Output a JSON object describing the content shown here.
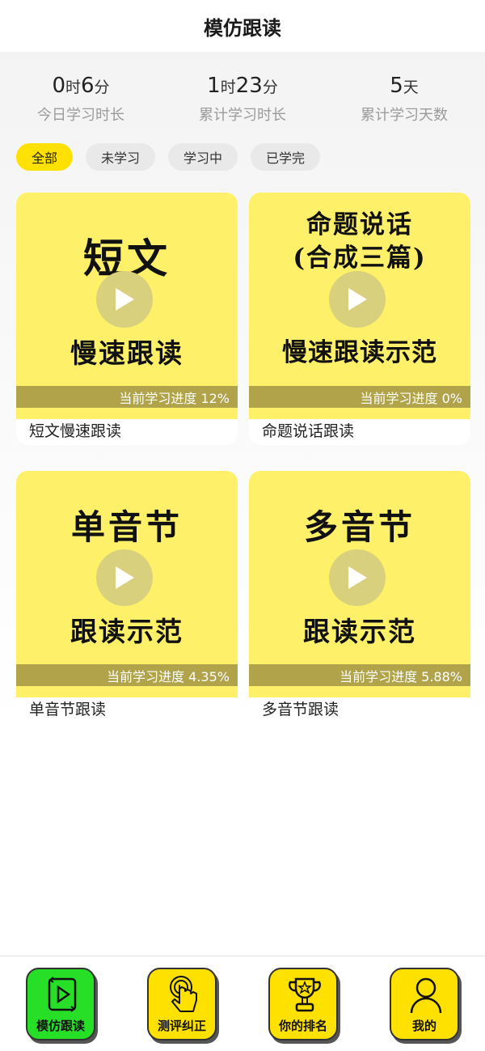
{
  "header": {
    "title": "模仿跟读"
  },
  "stats": [
    {
      "n1": "0",
      "u1": "时",
      "n2": "6",
      "u2": "分",
      "label": "今日学习时长"
    },
    {
      "n1": "1",
      "u1": "时",
      "n2": "23",
      "u2": "分",
      "label": "累计学习时长"
    },
    {
      "n1": "5",
      "u1": "天",
      "n2": "",
      "u2": "",
      "label": "累计学习天数"
    }
  ],
  "filters": [
    "全部",
    "未学习",
    "学习中",
    "已学完"
  ],
  "cards": [
    {
      "top": "短文",
      "top2": "",
      "bottom": "慢速跟读",
      "progress_text": "当前学习进度 12%",
      "progress": 12,
      "caption": "短文慢速跟读"
    },
    {
      "top": "命题说话",
      "top2": "(合成三篇)",
      "bottom": "慢速跟读示范",
      "progress_text": "当前学习进度 0%",
      "progress": 0,
      "caption": "命题说话跟读"
    },
    {
      "top": "单音节",
      "top2": "",
      "bottom": "跟读示范",
      "progress_text": "当前学习进度 4.35%",
      "progress": 4.35,
      "caption": "单音节跟读"
    },
    {
      "top": "多音节",
      "top2": "",
      "bottom": "跟读示范",
      "progress_text": "当前学习进度 5.88%",
      "progress": 5.88,
      "caption": "多音节跟读"
    }
  ],
  "tabs": [
    {
      "label": "模仿跟读",
      "icon": "play-icon",
      "active": true
    },
    {
      "label": "测评纠正",
      "icon": "touch-icon",
      "active": false
    },
    {
      "label": "你的排名",
      "icon": "trophy-icon",
      "active": false
    },
    {
      "label": "我的",
      "icon": "user-icon",
      "active": false
    }
  ],
  "colors": {
    "accent": "#ffe100",
    "card_bg": "#fff06a",
    "progress_bar": "#b0a34a",
    "active_tab": "#27df27"
  }
}
